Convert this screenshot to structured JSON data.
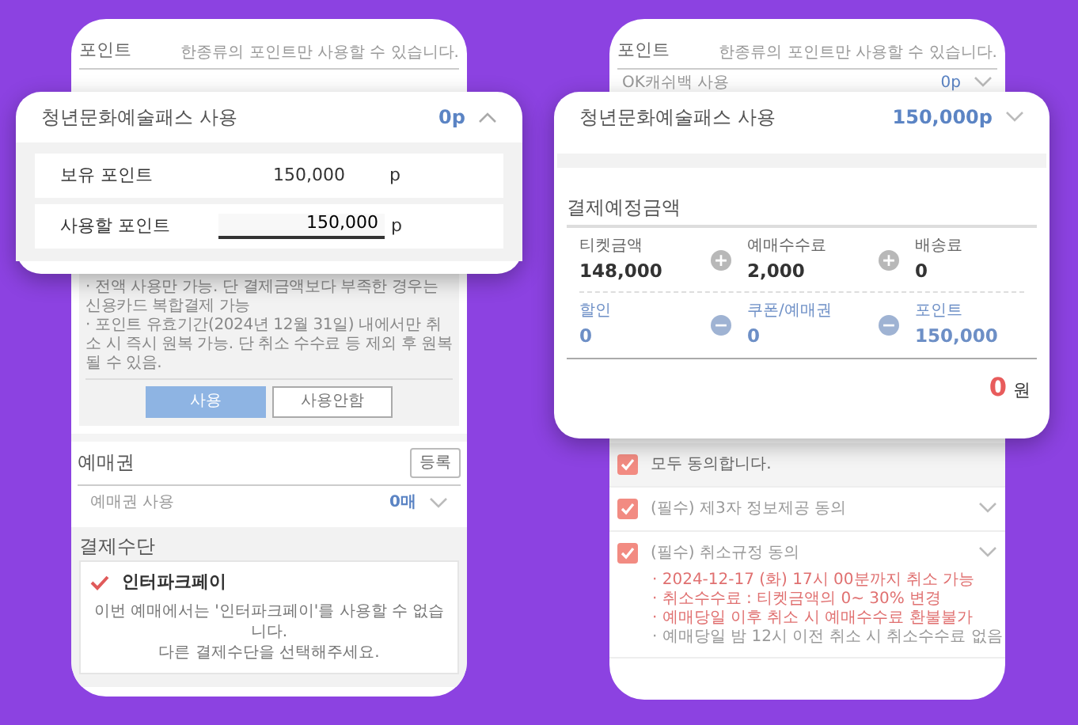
{
  "left": {
    "phone": {
      "points_title": "포인트",
      "points_hint": "한종류의 포인트만 사용할 수 있습니다.",
      "notes": [
        "· 전액 사용만 가능. 단 결제금액보다 부족한 경우는 신용카드 복합결제 가능",
        "· 포인트 유효기간(2024년 12월 31일) 내에서만 취소 시 즉시 원복 가능. 단 취소 수수료 등 제외 후 원복될 수 있음."
      ],
      "buttons": [
        {
          "label": "사용",
          "selected": true
        },
        {
          "label": "사용안함",
          "selected": false
        }
      ],
      "voucher": {
        "title": "예매권",
        "register_button": "등록",
        "row_label": "예매권 사용",
        "row_value": "0매"
      },
      "payment": {
        "title": "결제수단",
        "method": {
          "name": "인터파크페이",
          "checked": true
        },
        "message": [
          "이번 예매에서는 '인터파크페이'를 사용할 수 없습니다.",
          "다른 결제수단을 선택해주세요."
        ]
      }
    },
    "popup": {
      "title": "청년문화예술패스 사용",
      "value": "0p",
      "expanded": true,
      "rows": [
        {
          "kind": "static",
          "label": "보유 포인트",
          "value": "150,000",
          "unit": "p"
        },
        {
          "kind": "input",
          "label": "사용할 포인트",
          "value": "150,000",
          "unit": "p"
        }
      ]
    }
  },
  "right": {
    "phone": {
      "points_title": "포인트",
      "points_hint": "한종류의 포인트만 사용할 수 있습니다.",
      "row": {
        "label": "OK캐쉬백 사용",
        "value": "0p"
      },
      "agreements": [
        {
          "kind": "all",
          "label": "모두 동의합니다.",
          "checked": true
        },
        {
          "kind": "item",
          "label": "(필수) 제3자 정보제공 동의",
          "checked": true
        },
        {
          "kind": "item",
          "label": "(필수) 취소규정 동의",
          "checked": true,
          "notes": [
            {
              "text": "· 2024-12-17 (화) 17시 00분까지 취소 가능",
              "highlight": true
            },
            {
              "text": "· 취소수수료 : 티켓금액의 0~ 30% 변경",
              "highlight": true
            },
            {
              "text": "· 예매당일 이후 취소 시 예매수수료 환불불가",
              "highlight": true
            },
            {
              "text": "· 예매당일 밤 12시 이전 취소 시 취소수수료 없음",
              "highlight": false
            }
          ]
        }
      ]
    },
    "popup": {
      "title": "청년문화예술패스 사용",
      "value": "150,000p",
      "expanded": false,
      "summary_title": "결제예정금액",
      "items": [
        {
          "label": "티켓금액",
          "value": "148,000",
          "kind": "charge"
        },
        {
          "label": "예매수수료",
          "value": "2,000",
          "kind": "charge",
          "sign": "+"
        },
        {
          "label": "배송료",
          "value": "0",
          "kind": "charge",
          "sign": "+"
        },
        {
          "label": "할인",
          "value": "0",
          "kind": "discount"
        },
        {
          "label": "쿠폰/예매권",
          "value": "0",
          "kind": "discount",
          "sign": "−"
        },
        {
          "label": "포인트",
          "value": "150,000",
          "kind": "discount",
          "sign": "−"
        }
      ],
      "total": {
        "value": "0",
        "unit": "원"
      }
    }
  }
}
